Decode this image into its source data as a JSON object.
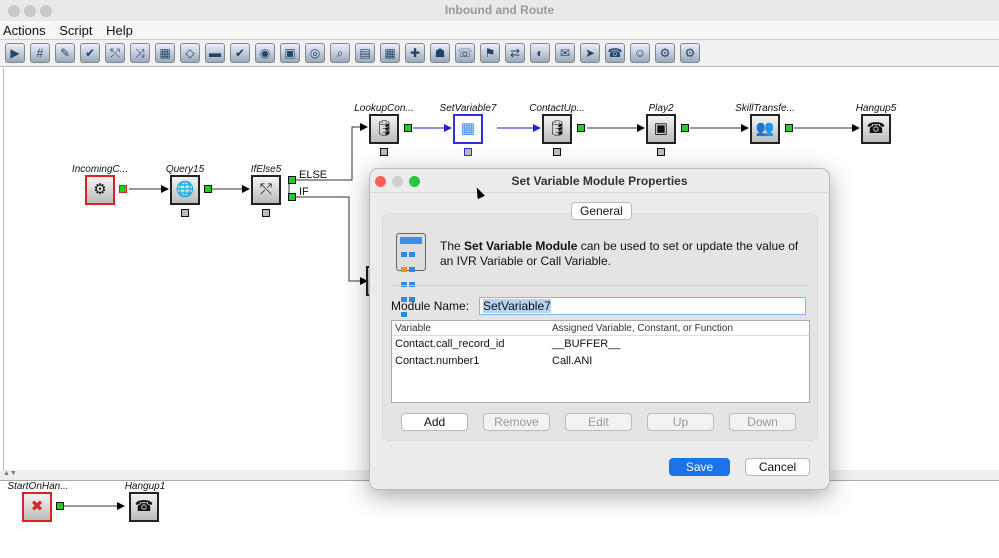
{
  "window": {
    "title": "Inbound and Route"
  },
  "menu": [
    {
      "label": "Actions"
    },
    {
      "label": "Script"
    },
    {
      "label": "Help"
    }
  ],
  "toolbar": {
    "icons": [
      "play-icon",
      "set-variable-icon",
      "input-icon",
      "check-icon",
      "if-else-icon",
      "case-icon",
      "calculator-icon",
      "goto-icon",
      "menu-icon",
      "verify-icon",
      "query-icon",
      "contact-update-icon",
      "lookup-icon",
      "search-icon",
      "db-update-icon",
      "calendar-icon",
      "add-icon",
      "agents-icon",
      "voicemail-icon",
      "skill-icon",
      "transfer-icon",
      "hold-icon",
      "email-icon",
      "send-icon",
      "hangup-icon",
      "agent-icon",
      "settings-icon",
      "advanced-settings-icon"
    ]
  },
  "canvas": {
    "nodes": {
      "incoming": "IncomingC...",
      "query": "Query15",
      "ifelse": "IfElse5",
      "lookup": "LookupCon...",
      "setvar": "SetVariable7",
      "contactup": "ContactUp...",
      "play": "Play2",
      "skill": "SkillTransfe...",
      "hangup5": "Hangup5",
      "starton": "StartOnHan...",
      "hangup1": "Hangup1"
    },
    "branches": {
      "else": "ELSE",
      "if": "IF"
    }
  },
  "dialog": {
    "title": "Set Variable Module Properties",
    "tab": "General",
    "desc_pre": "The ",
    "desc_bold": "Set Variable Module",
    "desc_post": " can be used to set or update the value of an IVR Variable or Call Variable.",
    "module_name_label": "Module Name:",
    "module_name_value": "SetVariable7",
    "table": {
      "headers": [
        "Variable",
        "Assigned Variable, Constant, or Function"
      ],
      "rows": [
        [
          "Contact.call_record_id",
          "__BUFFER__"
        ],
        [
          "Contact.number1",
          "Call.ANI"
        ]
      ]
    },
    "buttons": {
      "add": "Add",
      "remove": "Remove",
      "edit": "Edit",
      "up": "Up",
      "down": "Down",
      "save": "Save",
      "cancel": "Cancel"
    },
    "colors": {
      "save": "#1a73e8",
      "close": "#fe5f57",
      "zoom": "#28c840"
    }
  }
}
